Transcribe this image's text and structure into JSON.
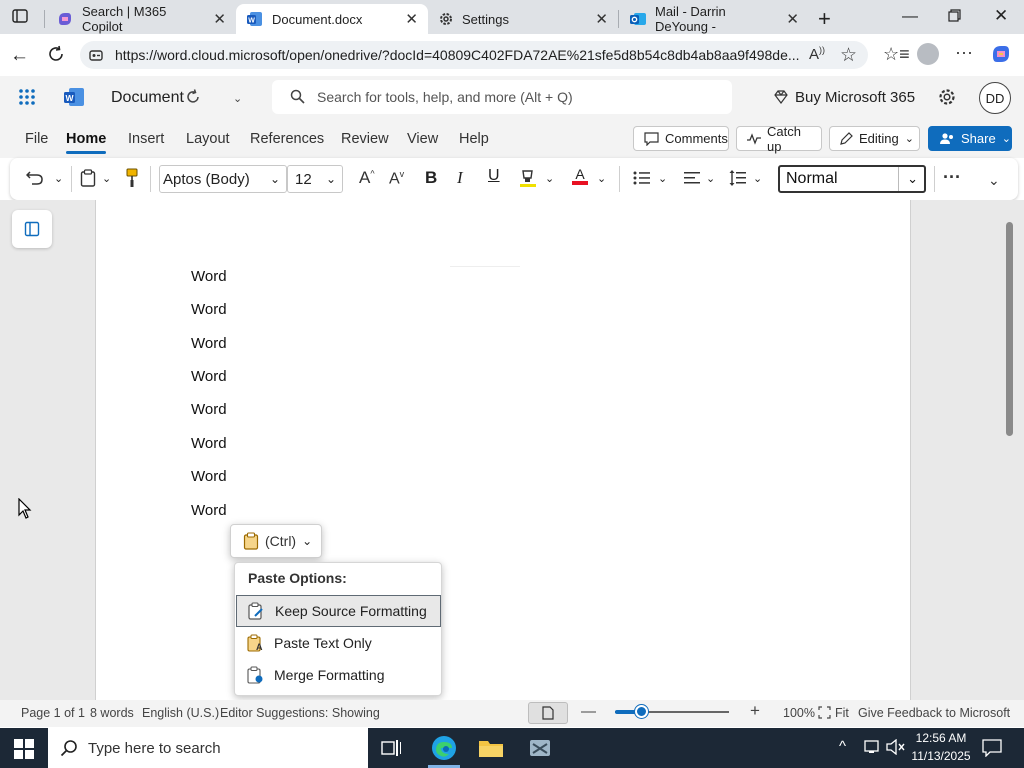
{
  "browser": {
    "tabs": [
      {
        "title": "Search | M365 Copilot"
      },
      {
        "title": "Document.docx"
      },
      {
        "title": "Settings"
      },
      {
        "title": "Mail - Darrin DeYoung -"
      }
    ],
    "url": "https://word.cloud.microsoft/open/onedrive/?docId=40809C402FDA72AE%21sfe5d8b54c8db4ab8aa9f498de..."
  },
  "office": {
    "doc_title": "Document",
    "search_placeholder": "Search for tools, help, and more (Alt + Q)",
    "buy_label": "Buy Microsoft 365",
    "avatar_initials": "DD"
  },
  "ribbon": {
    "tabs": [
      "File",
      "Home",
      "Insert",
      "Layout",
      "References",
      "Review",
      "View",
      "Help"
    ],
    "active_tab": "Home",
    "comments_label": "Comments",
    "catchup_label": "Catch up",
    "editing_label": "Editing",
    "share_label": "Share"
  },
  "toolbar": {
    "font_name": "Aptos (Body)",
    "font_size": "12",
    "style": "Normal"
  },
  "document": {
    "lines": [
      "Word",
      "Word",
      "Word",
      "Word",
      "Word",
      "Word",
      "Word",
      "Word"
    ]
  },
  "paste": {
    "ctrl_label": "(Ctrl)",
    "header": "Paste Options:",
    "options": [
      "Keep Source Formatting",
      "Paste Text Only",
      "Merge Formatting"
    ]
  },
  "status": {
    "page": "Page 1 of 1",
    "words": "8 words",
    "language": "English (U.S.)",
    "editor": "Editor Suggestions: Showing",
    "zoom": "100%",
    "fit": "Fit",
    "feedback": "Give Feedback to Microsoft"
  },
  "taskbar": {
    "search_placeholder": "Type here to search",
    "time": "12:56 AM",
    "date": "11/13/2025"
  },
  "colors": {
    "accent": "#0f6cbd",
    "font_color_bar": "#e81123",
    "taskbar": "#1c2836"
  }
}
